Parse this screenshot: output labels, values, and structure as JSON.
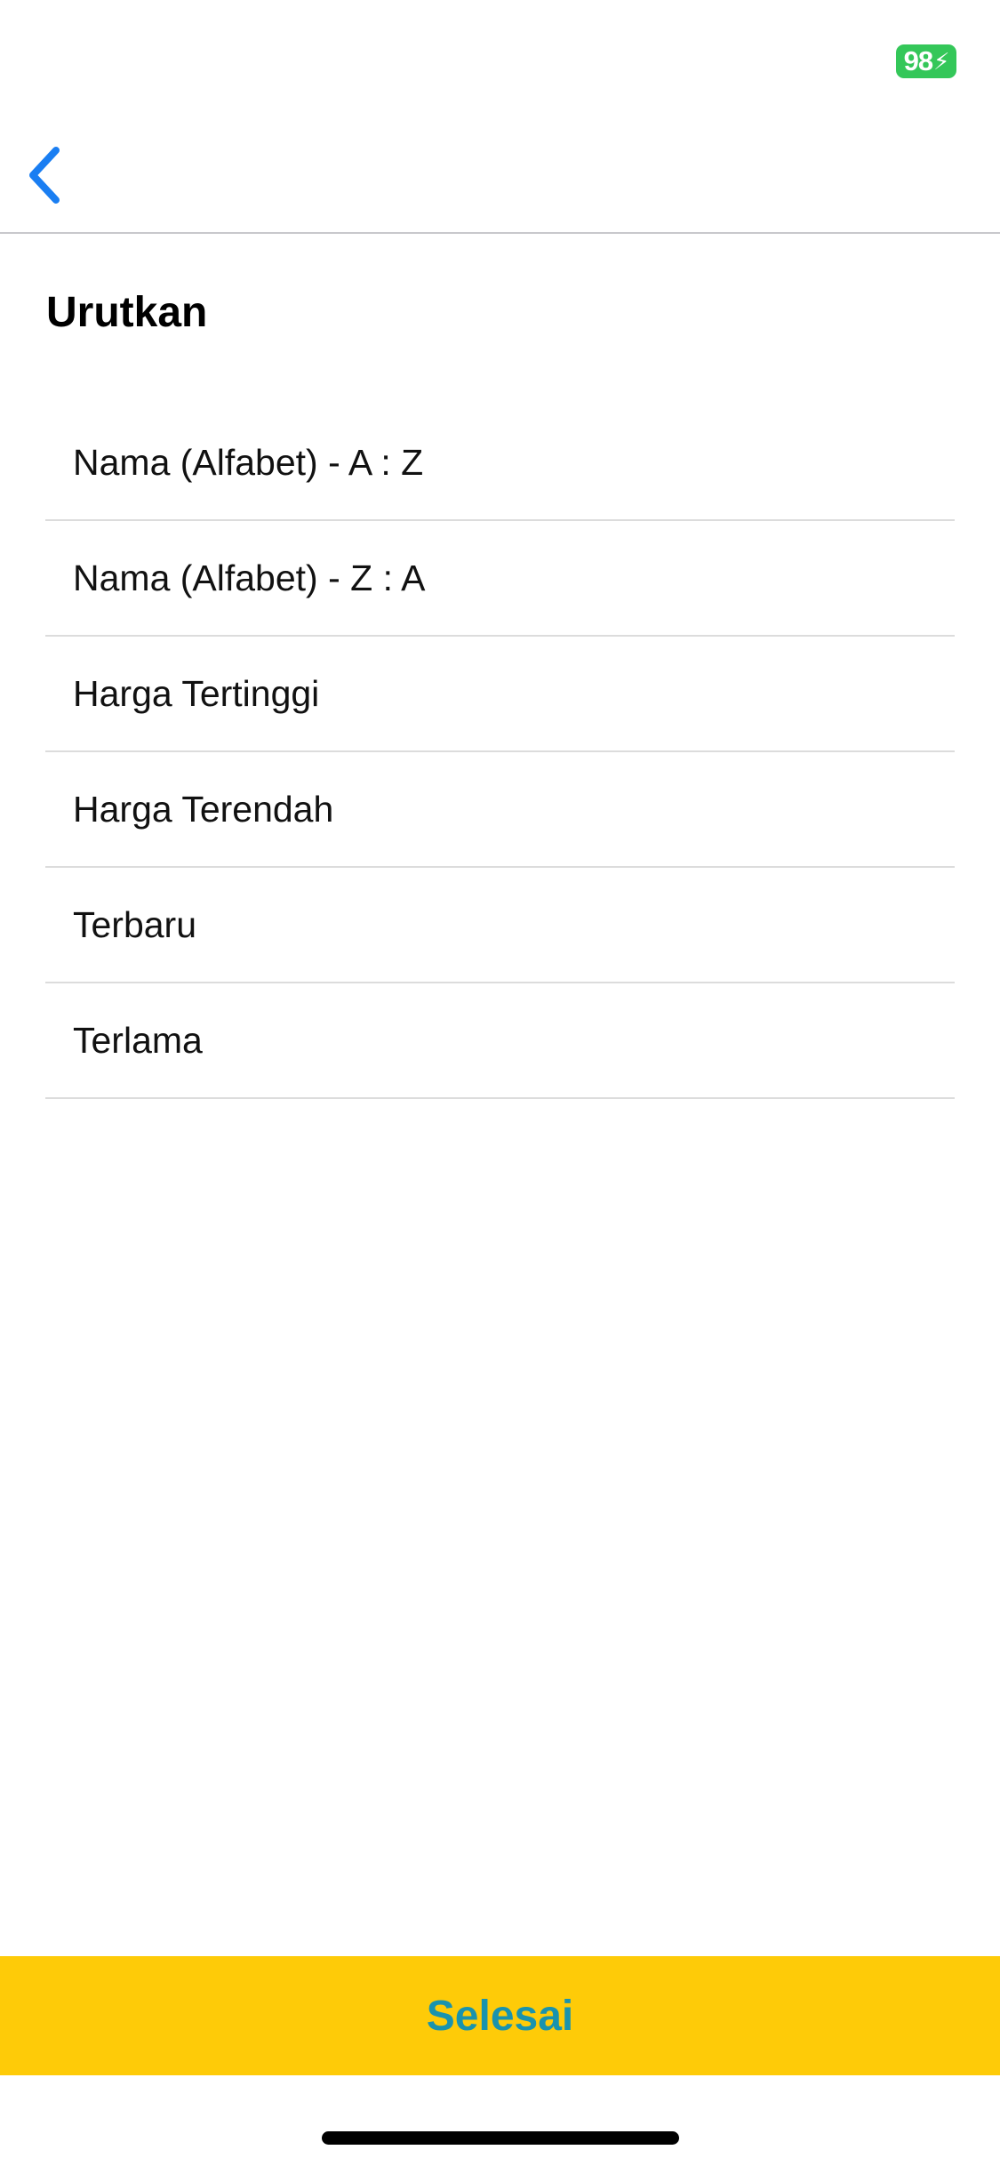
{
  "status_bar": {
    "battery_level": "98",
    "battery_icon": "battery-charging-icon",
    "battery_color": "#34c759"
  },
  "nav": {
    "back_icon": "chevron-left-icon",
    "back_color": "#1a7ef2"
  },
  "sort": {
    "title": "Urutkan",
    "options": [
      {
        "label": "Nama (Alfabet) - A : Z"
      },
      {
        "label": "Nama (Alfabet) - Z : A"
      },
      {
        "label": "Harga Tertinggi"
      },
      {
        "label": "Harga Terendah"
      },
      {
        "label": "Terbaru"
      },
      {
        "label": "Terlama"
      }
    ]
  },
  "footer": {
    "done_label": "Selesai",
    "done_bg_color": "#fecb08",
    "done_text_color": "#1a93ad"
  }
}
